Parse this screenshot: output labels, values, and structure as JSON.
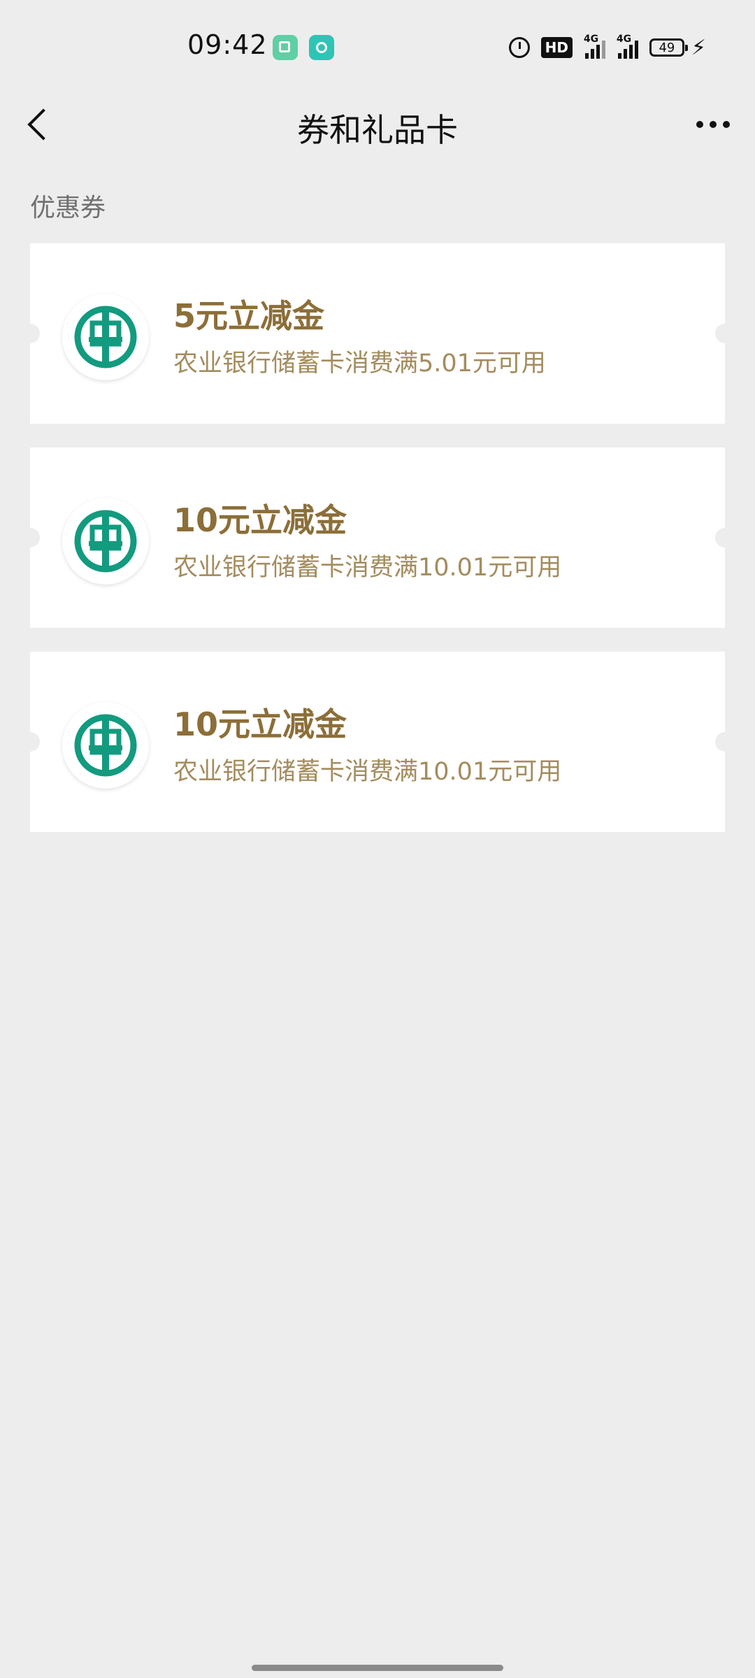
{
  "status_bar": {
    "time": "09:42",
    "hd_label": "HD",
    "network_1": "4G",
    "network_2": "4G",
    "battery": "49"
  },
  "nav": {
    "title": "券和礼品卡",
    "back_icon": "chevron-left-icon",
    "more_icon": "more-dots-icon"
  },
  "section": {
    "label": "优惠券"
  },
  "coupons": [
    {
      "title": "5元立减金",
      "desc": "农业银行储蓄卡消费满5.01元可用",
      "logo": "abc-bank-logo"
    },
    {
      "title": "10元立减金",
      "desc": "农业银行储蓄卡消费满10.01元可用",
      "logo": "abc-bank-logo"
    },
    {
      "title": "10元立减金",
      "desc": "农业银行储蓄卡消费满10.01元可用",
      "logo": "abc-bank-logo"
    }
  ],
  "colors": {
    "background": "#ededed",
    "coupon_title": "#8c6e38",
    "coupon_desc": "#a48c5e",
    "bank_green": "#129b7f"
  }
}
